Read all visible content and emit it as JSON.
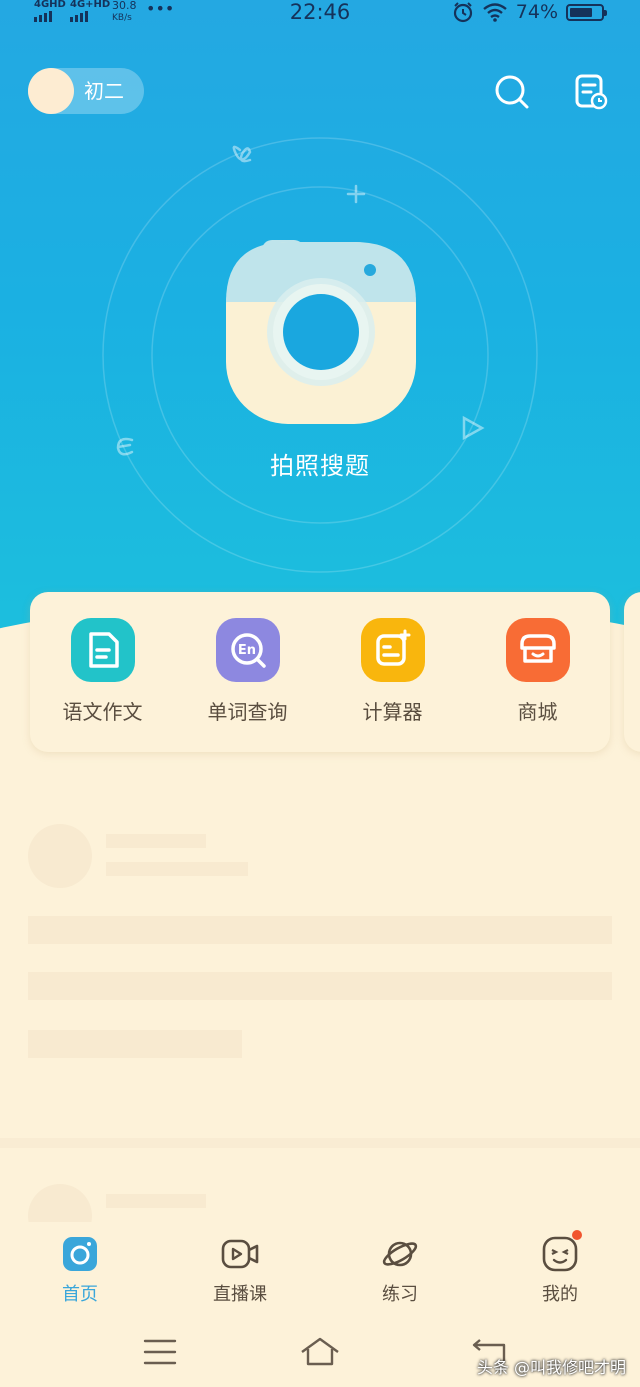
{
  "status_bar": {
    "signal1": "4GHD",
    "signal2": "4G+HD",
    "speed_value": "30.8",
    "speed_unit": "KB/s",
    "more": "•••",
    "time": "22:46",
    "battery_percent": "74%",
    "battery_level": 0.74
  },
  "header": {
    "grade_label": "初二",
    "search_icon": "search-icon",
    "history_icon": "doc-clock-icon"
  },
  "camera": {
    "caption": "拍照搜题",
    "icon": "camera-icon"
  },
  "tools": [
    {
      "label": "语文作文",
      "icon": "document-icon",
      "color": "#22c3c9"
    },
    {
      "label": "单词查询",
      "icon": "en-search-icon",
      "color": "#8d88e0"
    },
    {
      "label": "计算器",
      "icon": "calculator-icon",
      "color": "#f9b60d"
    },
    {
      "label": "商城",
      "icon": "store-icon",
      "color": "#f86c35"
    }
  ],
  "tabbar": {
    "tabs": [
      {
        "label": "首页",
        "icon": "camera-icon",
        "active": true
      },
      {
        "label": "直播课",
        "icon": "video-icon",
        "active": false
      },
      {
        "label": "练习",
        "icon": "planet-icon",
        "active": false
      },
      {
        "label": "我的",
        "icon": "face-icon",
        "active": false,
        "badge": true
      }
    ]
  },
  "navbar": {
    "menu_icon": "menu-icon",
    "home_icon": "home-icon",
    "back_icon": "back-icon"
  },
  "watermark": "头条 @叫我修吧才明",
  "colors": {
    "accent": "#3aa6da",
    "hero_top": "#24a8e2",
    "hero_bottom": "#1cc0dd",
    "background": "#fdf2d9",
    "badge": "#f1552e"
  }
}
